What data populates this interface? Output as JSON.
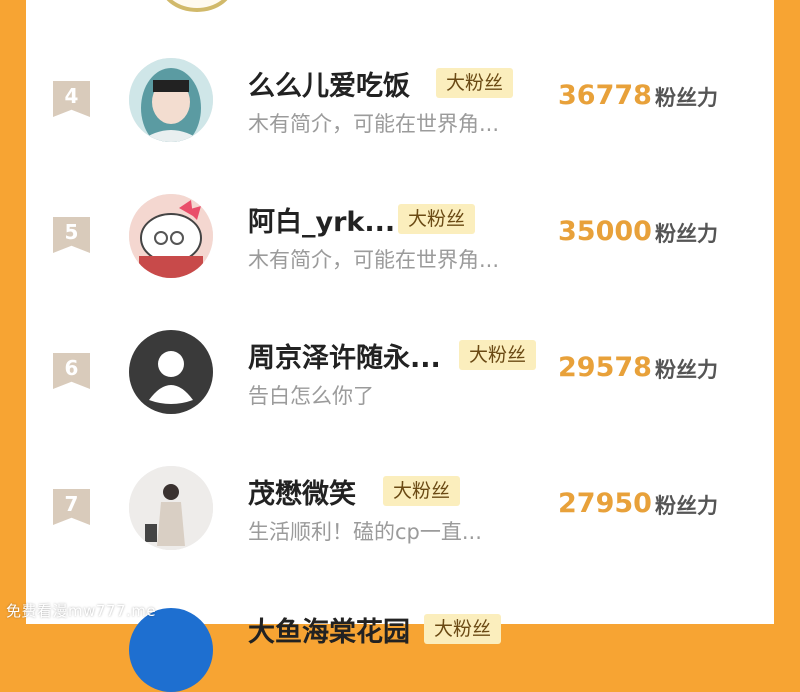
{
  "rows": [
    {
      "rank": "4",
      "name": "么么儿爱吃饭",
      "badge": "大粉丝",
      "desc": "木有简介，可能在世界角...",
      "score": "36778",
      "unit": "粉丝力"
    },
    {
      "rank": "5",
      "name": "阿白_yrk...",
      "badge": "大粉丝",
      "desc": "木有简介，可能在世界角...",
      "score": "35000",
      "unit": "粉丝力"
    },
    {
      "rank": "6",
      "name": "周京泽许随永...",
      "badge": "大粉丝",
      "desc": "告白怎么你了",
      "score": "29578",
      "unit": "粉丝力"
    },
    {
      "rank": "7",
      "name": "茂懋微笑",
      "badge": "大粉丝",
      "desc": "生活顺利！磕的cp一直...",
      "score": "27950",
      "unit": "粉丝力"
    }
  ],
  "partial_row": {
    "name": "大鱼海棠花园",
    "badge": "大粉丝"
  },
  "watermark": "免费看漫mw777.me",
  "colors": {
    "background": "#f7a433",
    "score": "#e8a13a",
    "badge_bg": "#fbeebd",
    "rank_bg": "#d9cbbb"
  }
}
